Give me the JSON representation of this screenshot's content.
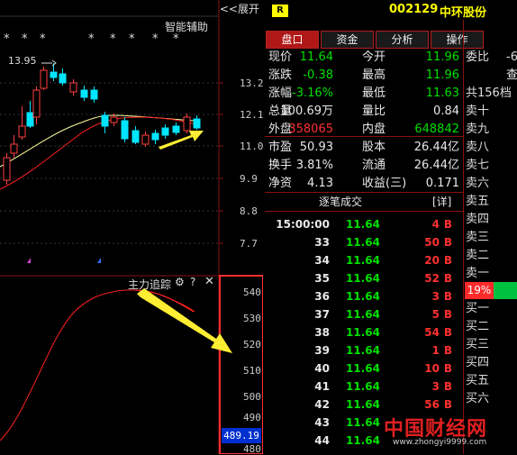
{
  "chart": {
    "expand_label": "<<展开",
    "assist_label": "智能辅助",
    "peak_label": "13.95",
    "star_markers": [
      "*",
      "*",
      "*",
      "*",
      "*",
      "*",
      "*",
      "*"
    ],
    "price_axis": [
      "13.2",
      "12.1",
      "11.0",
      "9.9",
      "8.8",
      "7.7"
    ],
    "indicator_title": "主力追踪",
    "indicator_axis": [
      "540",
      "530",
      "520",
      "510",
      "500",
      "490",
      "480"
    ],
    "current_indicator_value": "489.19",
    "colors": {
      "up": "#ff4040",
      "down": "#00e5ff",
      "ma_yellow": "#ffffa0",
      "ma_red": "#ff2020",
      "arrow": "#ffee33"
    }
  },
  "header": {
    "badge": "R",
    "code": "002129",
    "name": "中环股份"
  },
  "tabs": [
    {
      "label": "盘口",
      "active": true
    },
    {
      "label": "资金",
      "active": false
    },
    {
      "label": "分析",
      "active": false
    },
    {
      "label": "操作",
      "active": false
    }
  ],
  "quote": [
    {
      "l1": "现价",
      "v1": "11.64",
      "c1": "grn",
      "l2": "今开",
      "v2": "11.96",
      "c2": "grn"
    },
    {
      "l1": "涨跌",
      "v1": "-0.38",
      "c1": "grn",
      "l2": "最高",
      "v2": "11.96",
      "c2": "grn"
    },
    {
      "l1": "涨幅",
      "v1": "-3.16%",
      "c1": "grn",
      "l2": "最低",
      "v2": "11.63",
      "c2": "grn"
    },
    {
      "l1": "总量",
      "v1": "100.69万",
      "c1": "wht",
      "l2": "量比",
      "v2": "0.84",
      "c2": "wht"
    },
    {
      "l1": "外盘",
      "v1": "358065",
      "c1": "red",
      "l2": "内盘",
      "v2": "648842",
      "c2": "grn"
    },
    {
      "l1": "市盈",
      "v1": "50.93",
      "c1": "wht",
      "l2": "股本",
      "v2": "26.44亿",
      "c2": "wht"
    },
    {
      "l1": "换手",
      "v1": "3.81%",
      "c1": "wht",
      "l2": "流通",
      "v2": "26.44亿",
      "c2": "wht"
    },
    {
      "l1": "净资",
      "v1": "4.13",
      "c1": "wht",
      "l2": "收益(三)",
      "v2": "0.171",
      "c2": "wht"
    }
  ],
  "ticks_header": {
    "title": "逐笔成交",
    "detail": "[详]"
  },
  "ticks": [
    {
      "time": "15:00:00",
      "price": "11.64",
      "vol": "4",
      "side": "B"
    },
    {
      "time": "33",
      "price": "11.64",
      "vol": "50",
      "side": "B"
    },
    {
      "time": "34",
      "price": "11.64",
      "vol": "20",
      "side": "B"
    },
    {
      "time": "35",
      "price": "11.64",
      "vol": "52",
      "side": "B"
    },
    {
      "time": "36",
      "price": "11.64",
      "vol": "3",
      "side": "B"
    },
    {
      "time": "37",
      "price": "11.64",
      "vol": "5",
      "side": "B"
    },
    {
      "time": "38",
      "price": "11.64",
      "vol": "54",
      "side": "B"
    },
    {
      "time": "39",
      "price": "11.64",
      "vol": "1",
      "side": "B"
    },
    {
      "time": "40",
      "price": "11.64",
      "vol": "10",
      "side": "B"
    },
    {
      "time": "41",
      "price": "11.64",
      "vol": "3",
      "side": "B"
    },
    {
      "time": "42",
      "price": "11.64",
      "vol": "56",
      "side": "B"
    },
    {
      "time": "43",
      "price": "11.64",
      "vol": "",
      "side": ""
    },
    {
      "time": "44",
      "price": "11.64",
      "vol": "",
      "side": ""
    }
  ],
  "orderbook": {
    "wb_label": "委比",
    "wb_value": "-6",
    "search_label": "查",
    "total_label": "共156档",
    "sells": [
      "卖十",
      "卖九",
      "卖八",
      "卖七",
      "卖六",
      "卖五",
      "卖四",
      "卖三",
      "卖二",
      "卖一"
    ],
    "ratio": "19%",
    "buys": [
      "买一",
      "买二",
      "买三",
      "买四",
      "买五",
      "买六"
    ]
  },
  "watermark": {
    "brand": "中国财经网",
    "url": "www.zhongyi9999.com"
  }
}
